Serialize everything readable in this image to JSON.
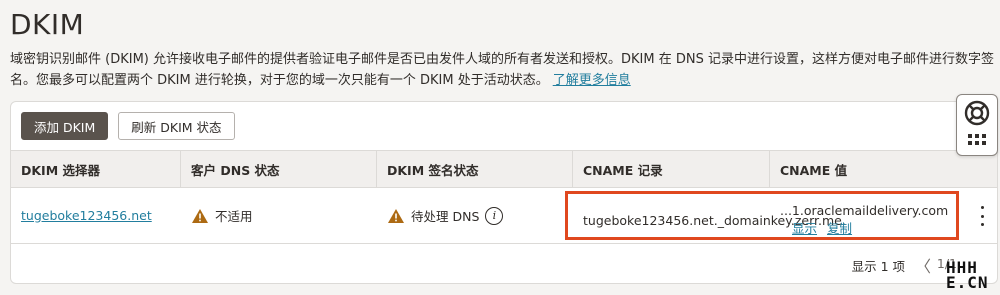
{
  "page": {
    "title": "DKIM",
    "description": "域密钥识别邮件 (DKIM) 允许接收电子邮件的提供者验证电子邮件是否已由发件人域的所有者发送和授权。DKIM 在 DNS 记录中进行设置，这样方便对电子邮件进行数字签名。您最多可以配置两个 DKIM 进行轮换，对于您的域一次只能有一个 DKIM 处于活动状态。",
    "learn_more": "了解更多信息"
  },
  "toolbar": {
    "add_label": "添加 DKIM",
    "refresh_label": "刷新 DKIM 状态"
  },
  "table": {
    "headers": {
      "selector": "DKIM 选择器",
      "dns_status": "客户 DNS 状态",
      "signing_status": "DKIM 签名状态",
      "cname_record": "CNAME 记录",
      "cname_value": "CNAME 值"
    },
    "rows": [
      {
        "selector": "tugeboke123456.net",
        "dns_status": "不适用",
        "signing_status": "待处理 DNS",
        "cname_record": "tugeboke123456.net._domainkey.zerr.me.",
        "cname_value": "...1.oraclemaildelivery.com",
        "show": "显示",
        "copy": "复制"
      }
    ]
  },
  "footer": {
    "showing": "显示 1 项",
    "prev": "〈",
    "page": "1/1"
  },
  "watermark": {
    "line1": "HHH",
    "line2": "E.CN"
  },
  "colors": {
    "accent_link": "#227e9e",
    "primary_button": "#5a534d",
    "highlight": "#e0481f",
    "warning": "#ad6a13"
  }
}
